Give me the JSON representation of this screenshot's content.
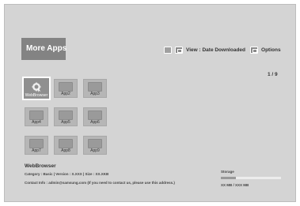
{
  "header": {
    "title": "More Apps"
  },
  "toolbar": {
    "view_label": "View : Date Downloaded",
    "options_label": "Options"
  },
  "pagination": "1 / 9",
  "apps": [
    {
      "label": "WebBrowser",
      "selected": true
    },
    {
      "label": "App2"
    },
    {
      "label": "App3"
    },
    {
      "label": "App4"
    },
    {
      "label": "App5"
    },
    {
      "label": "App6"
    },
    {
      "label": "App7"
    },
    {
      "label": "App8"
    },
    {
      "label": "App9"
    }
  ],
  "info": {
    "name": "WebBrowser",
    "details": "Category : Basic  |  Version : X.XXX  |  Size : XX.XKB",
    "contact": "Contact Info : admin@samsung.com (If you need to contact us, please use this address.)"
  },
  "storage": {
    "label": "Storage",
    "value": "XX MB / XXX MB",
    "fill_fraction": 0.25
  }
}
